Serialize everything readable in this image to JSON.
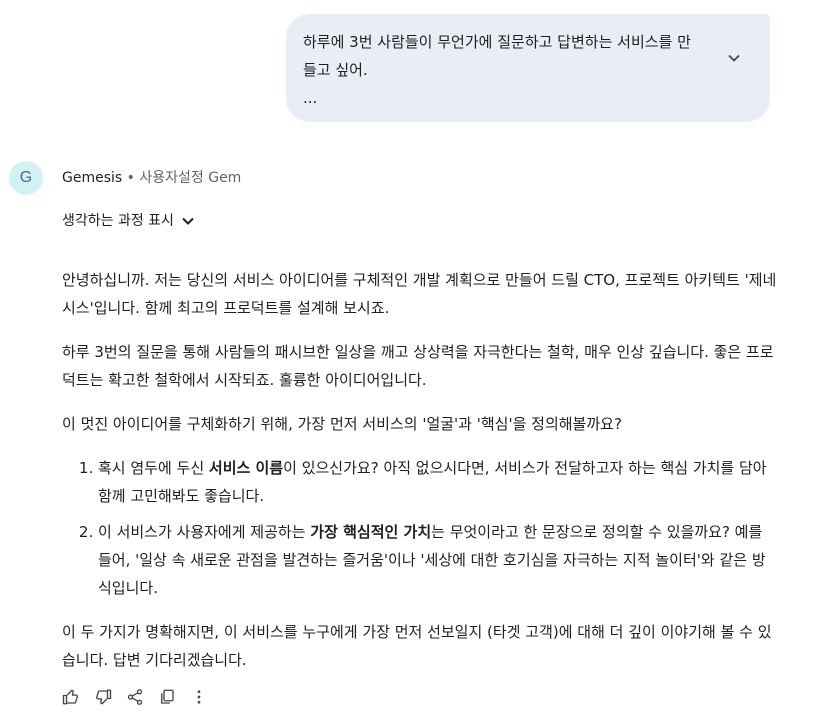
{
  "user_message": {
    "line1": "하루에 3번 사람들이 무언가에 질문하고 답변하는 서비스를 만",
    "line2": "들고 싶어.",
    "line3": "..."
  },
  "gem": {
    "avatar_letter": "G",
    "name": "Gemesis",
    "separator": " • ",
    "type": "사용자설정 Gem"
  },
  "thinking_toggle": "생각하는 과정 표시",
  "response": {
    "p1": "안녕하십니까. 저는 당신의 서비스 아이디어를 구체적인 개발 계획으로 만들어 드릴 CTO, 프로젝트 아키텍트 '제네시스'입니다. 함께 최고의 프로덕트를 설계해 보시죠.",
    "p2": "하루 3번의 질문을 통해 사람들의 패시브한 일상을 깨고 상상력을 자극한다는 철학, 매우 인상 깊습니다. 좋은 프로덕트는 확고한 철학에서 시작되죠. 훌륭한 아이디어입니다.",
    "p3": "이 멋진 아이디어를 구체화하기 위해, 가장 먼저 서비스의 '얼굴'과 '핵심'을 정의해볼까요?",
    "item1_pre": "혹시 염두에 두신 ",
    "item1_bold": "서비스 이름",
    "item1_post": "이 있으신가요? 아직 없으시다면, 서비스가 전달하고자 하는 핵심 가치를 담아 함께 고민해봐도 좋습니다.",
    "item2_pre": "이 서비스가 사용자에게 제공하는 ",
    "item2_bold": "가장 핵심적인 가치",
    "item2_post": "는 무엇이라고 한 문장으로 정의할 수 있을까요? 예를 들어, '일상 속 새로운 관점을 발견하는 즐거움'이나 '세상에 대한 호기심을 자극하는 지적 놀이터'와 같은 방식입니다.",
    "p4": "이 두 가지가 명확해지면, 이 서비스를 누구에게 가장 먼저 선보일지 (타겟 고객)에 대해 더 깊이 이야기해 볼 수 있습니다. 답변 기다리겠습니다."
  },
  "colors": {
    "bubble_bg": "#e9eef6",
    "avatar_bg": "#d3f0f2",
    "text": "#1f1f1f",
    "muted": "#5f6368"
  },
  "icons": [
    "chevron-down-icon",
    "thumbs-up-icon",
    "thumbs-down-icon",
    "share-icon",
    "copy-icon",
    "more-vert-icon"
  ]
}
